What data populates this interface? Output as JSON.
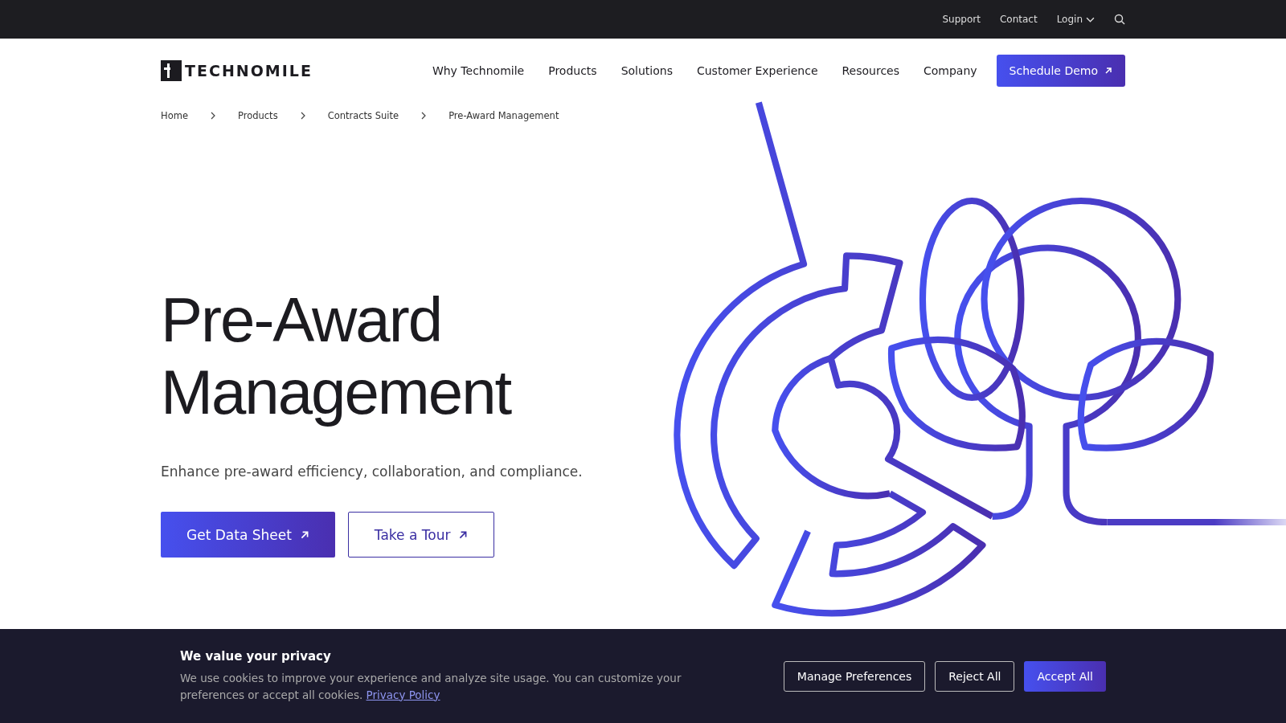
{
  "top_bar": {
    "links": [
      {
        "label": "Support",
        "kind": "link"
      },
      {
        "label": "Contact",
        "kind": "link"
      },
      {
        "label": "Login",
        "kind": "dropdown"
      }
    ]
  },
  "header": {
    "logo": "TECHNOMILE",
    "nav": [
      "Why Technomile",
      "Products",
      "Solutions",
      "Customer Experience",
      "Resources",
      "Company"
    ],
    "cta": "Schedule Demo"
  },
  "breadcrumb": [
    "Home",
    "Products",
    "Contracts Suite",
    "Pre-Award Management"
  ],
  "hero": {
    "title_lines": [
      "Pre-Award",
      "Management"
    ],
    "subtitle": "Enhance pre-award efficiency, collaboration, and compliance.",
    "buttons": [
      {
        "label": "Get Data Sheet",
        "kind": "primary"
      },
      {
        "label": "Take a Tour",
        "kind": "outline"
      }
    ]
  },
  "cookie_banner": {
    "title": "We value your privacy",
    "text": "We use cookies to improve your experience and analyze site usage. You can customize your preferences or accept all cookies.",
    "link": "Privacy Policy",
    "buttons": [
      {
        "label": "Manage Preferences",
        "kind": "outline"
      },
      {
        "label": "Reject All",
        "kind": "outline"
      },
      {
        "label": "Accept All",
        "kind": "primary"
      }
    ]
  }
}
